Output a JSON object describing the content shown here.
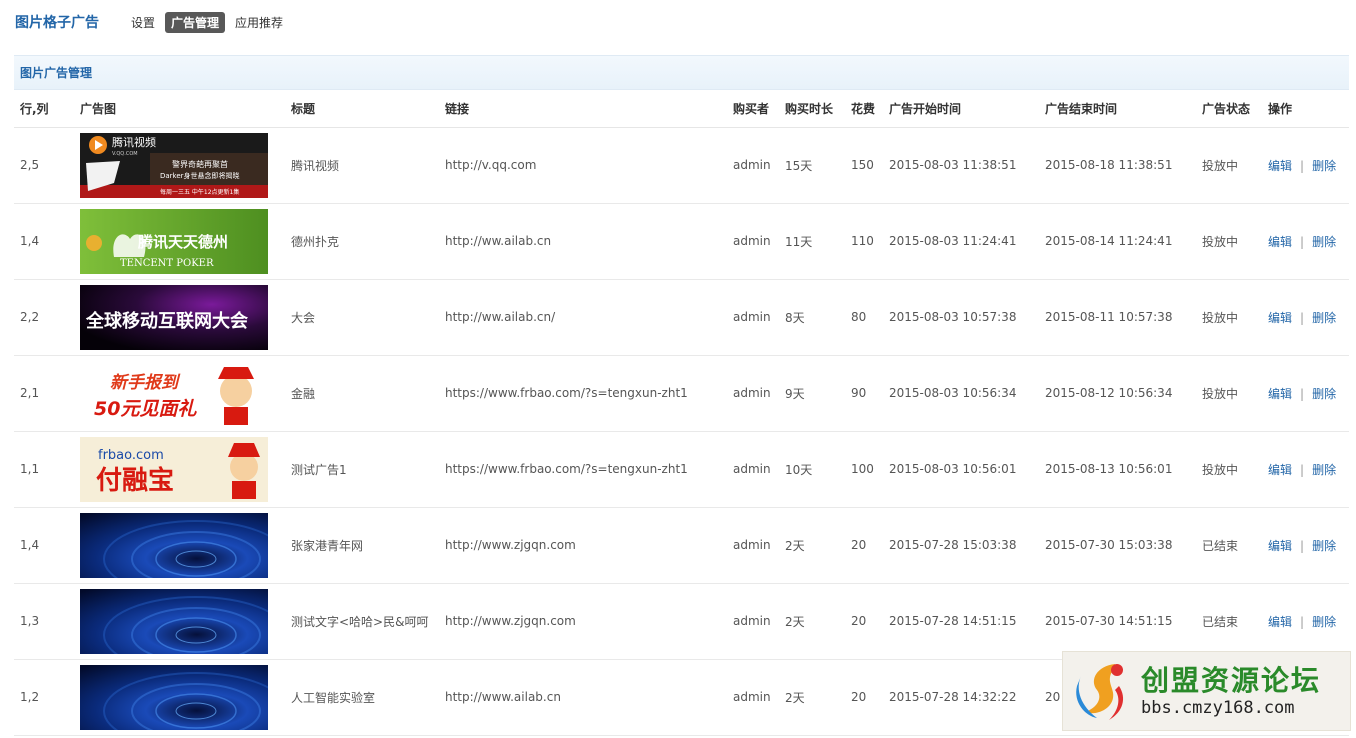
{
  "header": {
    "app_title": "图片格子广告",
    "tabs": [
      {
        "label": "设置"
      },
      {
        "label": "广告管理"
      },
      {
        "label": "应用推荐"
      }
    ]
  },
  "section": {
    "title": "图片广告管理"
  },
  "table": {
    "columns": [
      "行,列",
      "广告图",
      "标题",
      "链接",
      "购买者",
      "购买时长",
      "花费",
      "广告开始时间",
      "广告结束时间",
      "广告状态",
      "操作"
    ],
    "edit_label": "编辑",
    "separator": "|",
    "delete_label": "删除",
    "rows": [
      {
        "pos": "2,5",
        "thumb": "tencent-video-banner",
        "thumb_text": [
          "腾讯视频",
          "V.QQ.COM",
          "警界奇葩再聚首",
          "Darker身世悬念即将揭晓",
          "每周一三五 中午12点更新1集"
        ],
        "title": "腾讯视频",
        "link": "http://v.qq.com",
        "buyer": "admin",
        "duration": "15天",
        "cost": "150",
        "start": "2015-08-03 11:38:51",
        "end": "2015-08-18 11:38:51",
        "status": "投放中"
      },
      {
        "pos": "1,4",
        "thumb": "tencent-poker-banner",
        "thumb_text": [
          "腾讯天天德州",
          "TENCENT POKER"
        ],
        "title": "德州扑克",
        "link": "http://ww.ailab.cn",
        "buyer": "admin",
        "duration": "11天",
        "cost": "110",
        "start": "2015-08-03 11:24:41",
        "end": "2015-08-14 11:24:41",
        "status": "投放中"
      },
      {
        "pos": "2,2",
        "thumb": "mobile-internet-conference-banner",
        "thumb_text": [
          "全球移动互联网大会"
        ],
        "title": "大会",
        "link": "http://ww.ailab.cn/",
        "buyer": "admin",
        "duration": "8天",
        "cost": "80",
        "start": "2015-08-03 10:57:38",
        "end": "2015-08-11 10:57:38",
        "status": "投放中"
      },
      {
        "pos": "2,1",
        "thumb": "finance-newcomer-banner",
        "thumb_text": [
          "新手报到",
          "50元见面礼"
        ],
        "title": "金融",
        "link": "https://www.frbao.com/?s=tengxun-zht1",
        "buyer": "admin",
        "duration": "9天",
        "cost": "90",
        "start": "2015-08-03 10:56:34",
        "end": "2015-08-12 10:56:34",
        "status": "投放中"
      },
      {
        "pos": "1,1",
        "thumb": "frbao-banner",
        "thumb_text": [
          "frbao.com",
          "付融宝"
        ],
        "title": "测试广告1",
        "link": "https://www.frbao.com/?s=tengxun-zht1",
        "buyer": "admin",
        "duration": "10天",
        "cost": "100",
        "start": "2015-08-03 10:56:01",
        "end": "2015-08-13 10:56:01",
        "status": "投放中"
      },
      {
        "pos": "1,4",
        "thumb": "blue-vortex-image",
        "thumb_text": [],
        "title": "张家港青年网",
        "link": "http://www.zjgqn.com",
        "buyer": "admin",
        "duration": "2天",
        "cost": "20",
        "start": "2015-07-28 15:03:38",
        "end": "2015-07-30 15:03:38",
        "status": "已结束"
      },
      {
        "pos": "1,3",
        "thumb": "blue-vortex-image",
        "thumb_text": [],
        "title": "测试文字<哈哈>民&呵呵",
        "link": "http://www.zjgqn.com",
        "buyer": "admin",
        "duration": "2天",
        "cost": "20",
        "start": "2015-07-28 14:51:15",
        "end": "2015-07-30 14:51:15",
        "status": "已结束"
      },
      {
        "pos": "1,2",
        "thumb": "blue-vortex-image",
        "thumb_text": [],
        "title": "人工智能实验室",
        "link": "http://www.ailab.cn",
        "buyer": "admin",
        "duration": "2天",
        "cost": "20",
        "start": "2015-07-28 14:32:22",
        "end": "20",
        "status": ""
      }
    ]
  },
  "watermark": {
    "title": "创盟资源论坛",
    "url": "bbs.cmzy168.com",
    "icon": "cmzy-logo-icon"
  },
  "colors": {
    "accent": "#2366a8",
    "active_tab_bg": "#585858",
    "status_running": "#1a8a1a",
    "status_ended": "#c01010",
    "section_bg": "#eaf3fb"
  }
}
